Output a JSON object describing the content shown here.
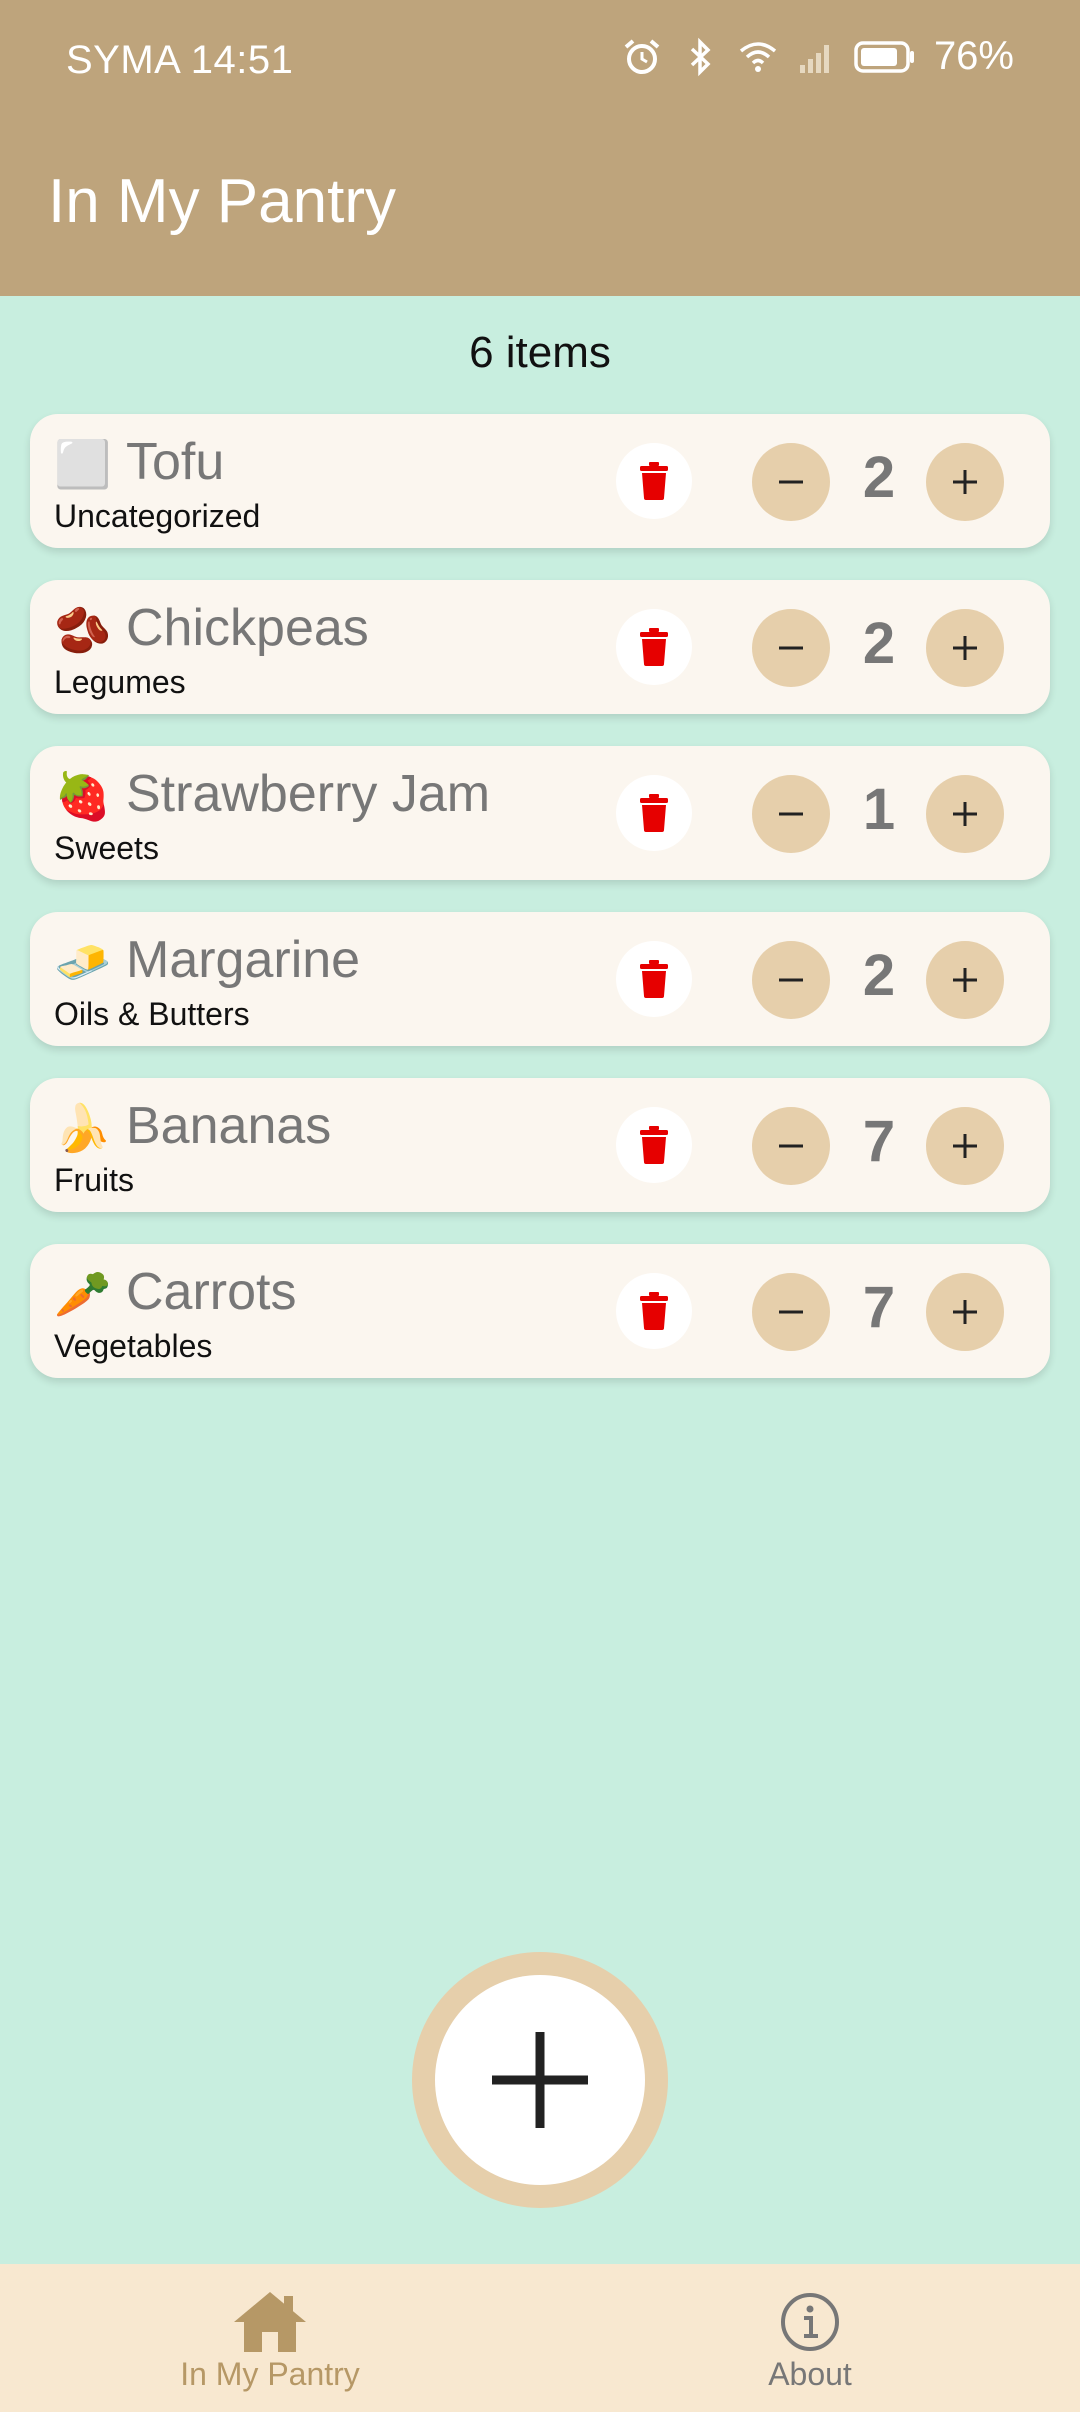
{
  "status_bar": {
    "carrier_time": "SYMA 14:51",
    "battery_pct": "76%"
  },
  "app_bar": {
    "title": "In My Pantry"
  },
  "summary": {
    "count_text": "6 items"
  },
  "items": [
    {
      "emoji": "⬜",
      "name": "Tofu",
      "category": "Uncategorized",
      "quantity": "2"
    },
    {
      "emoji": "🫘",
      "name": "Chickpeas",
      "category": "Legumes",
      "quantity": "2"
    },
    {
      "emoji": "🍓",
      "name": "Strawberry Jam",
      "category": "Sweets",
      "quantity": "1"
    },
    {
      "emoji": "🧈",
      "name": "Margarine",
      "category": "Oils & Butters",
      "quantity": "2"
    },
    {
      "emoji": "🍌",
      "name": "Bananas",
      "category": "Fruits",
      "quantity": "7"
    },
    {
      "emoji": "🥕",
      "name": "Carrots",
      "category": "Vegetables",
      "quantity": "7"
    }
  ],
  "bottom_nav": [
    {
      "label": "In My Pantry",
      "icon": "home-icon",
      "active": true
    },
    {
      "label": "About",
      "icon": "info-icon",
      "active": false
    }
  ],
  "colors": {
    "app_bar": "#bea47c",
    "background": "#c8eedf",
    "card": "#fbf6ef",
    "stepper": "#e6cfab",
    "delete": "#e60000",
    "bottom_nav": "#f8e8d0",
    "nav_active": "#b69866"
  }
}
